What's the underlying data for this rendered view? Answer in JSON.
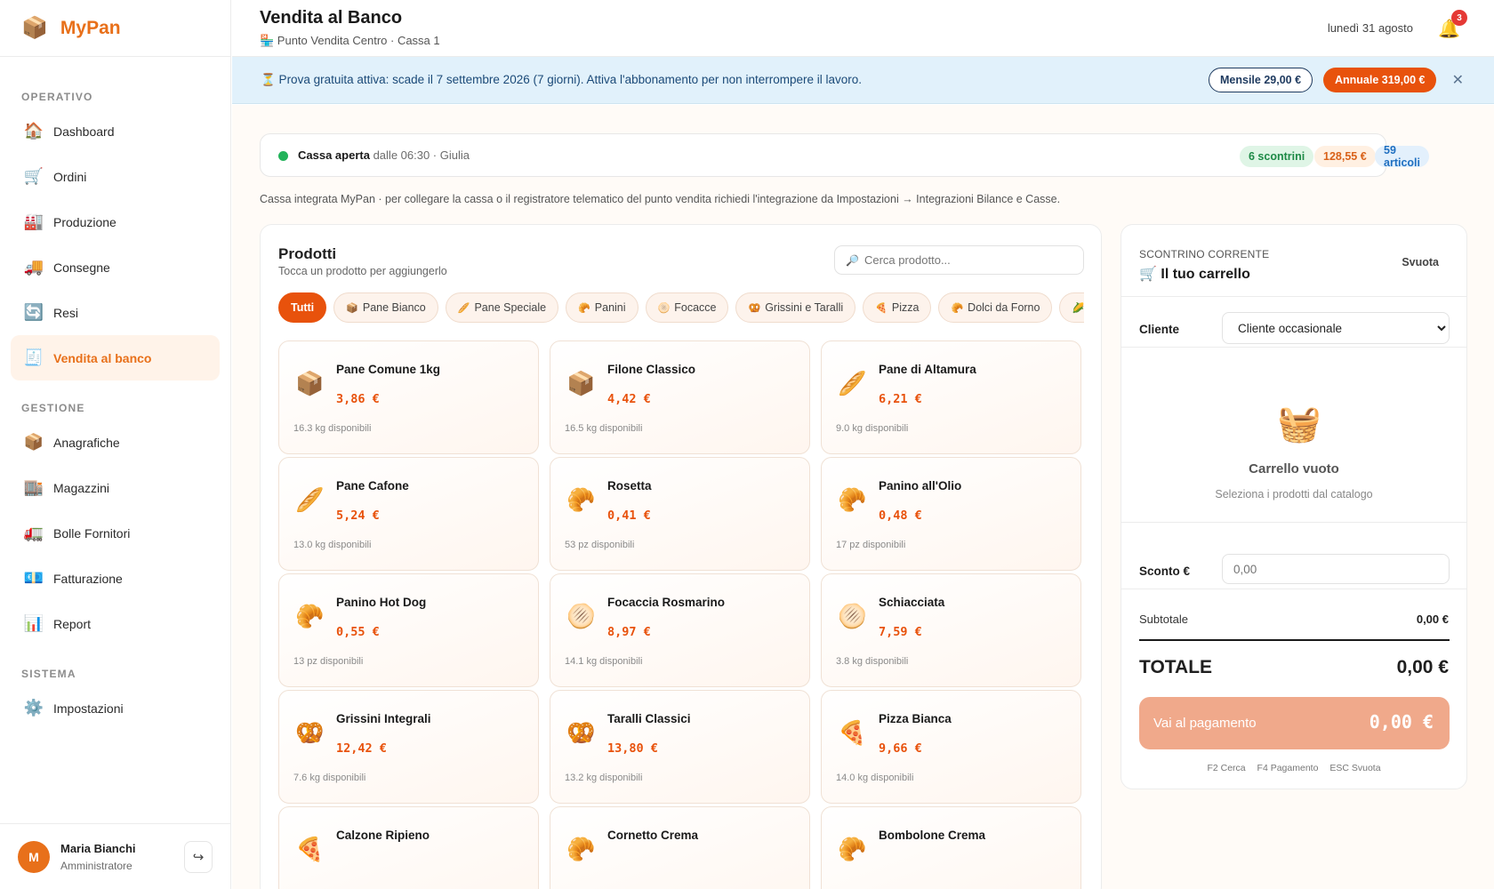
{
  "brand": {
    "logo": "📦",
    "name": "MyPan"
  },
  "sidebar": {
    "sections": [
      "OPERATIVO",
      "GESTIONE",
      "SISTEMA"
    ],
    "items": [
      {
        "icon": "🏠",
        "label": "Dashboard"
      },
      {
        "icon": "🛒",
        "label": "Ordini"
      },
      {
        "icon": "🏭",
        "label": "Produzione"
      },
      {
        "icon": "🚚",
        "label": "Consegne"
      },
      {
        "icon": "🔄",
        "label": "Resi"
      },
      {
        "icon": "🧾",
        "label": "Vendita al banco",
        "active": true
      },
      {
        "icon": "📦",
        "label": "Anagrafiche"
      },
      {
        "icon": "🏬",
        "label": "Magazzini"
      },
      {
        "icon": "🚛",
        "label": "Bolle Fornitori"
      },
      {
        "icon": "💶",
        "label": "Fatturazione"
      },
      {
        "icon": "📊",
        "label": "Report"
      },
      {
        "icon": "⚙️",
        "label": "Impostazioni"
      }
    ],
    "user": {
      "initial": "M",
      "name": "Maria Bianchi",
      "role": "Amministratore",
      "logout_icon": "↪"
    }
  },
  "header": {
    "title": "Vendita al Banco",
    "subtitle": "🏪 Punto Vendita Centro · Cassa 1",
    "date": "lunedì 31 agosto",
    "notifications_count": "3"
  },
  "banner": {
    "text": "⏳ Prova gratuita attiva: scade il 7 settembre 2026 (7 giorni). Attiva l'abbonamento per non interrompere il lavoro.",
    "monthly_label": "Mensile 29,00 €",
    "annual_label": "Annuale 319,00 €",
    "close_icon": "✕"
  },
  "cassa": {
    "status_label": "Cassa aperta",
    "status_detail": "dalle 06:30 · Giulia",
    "receipts": "6 scontrini",
    "total": "128,55 €",
    "articles": "59 articoli",
    "info": "Cassa integrata MyPan · per collegare la cassa o il registratore telematico del punto vendita richiedi l'integrazione da Impostazioni → Integrazioni Bilance e Casse."
  },
  "products": {
    "title": "Prodotti",
    "subtitle": "Tocca un prodotto per aggiungerlo",
    "search_placeholder": "Cerca prodotto...",
    "categories": [
      {
        "icon": "",
        "label": "Tutti",
        "active": true
      },
      {
        "icon": "📦",
        "label": "Pane Bianco"
      },
      {
        "icon": "🥖",
        "label": "Pane Speciale"
      },
      {
        "icon": "🥐",
        "label": "Panini"
      },
      {
        "icon": "🫓",
        "label": "Focacce"
      },
      {
        "icon": "🥨",
        "label": "Grissini e Taralli"
      },
      {
        "icon": "🍕",
        "label": "Pizza"
      },
      {
        "icon": "🥐",
        "label": "Dolci da Forno"
      },
      {
        "icon": "🌽",
        "label": ""
      }
    ],
    "items": [
      {
        "icon": "📦",
        "name": "Pane Comune 1kg",
        "price": "3,86 €",
        "stock": "16.3 kg disponibili"
      },
      {
        "icon": "📦",
        "name": "Filone Classico",
        "price": "4,42 €",
        "stock": "16.5 kg disponibili"
      },
      {
        "icon": "🥖",
        "name": "Pane di Altamura",
        "price": "6,21 €",
        "stock": "9.0 kg disponibili"
      },
      {
        "icon": "🥖",
        "name": "Pane Cafone",
        "price": "5,24 €",
        "stock": "13.0 kg disponibili"
      },
      {
        "icon": "🥐",
        "name": "Rosetta",
        "price": "0,41 €",
        "stock": "53 pz disponibili"
      },
      {
        "icon": "🥐",
        "name": "Panino all'Olio",
        "price": "0,48 €",
        "stock": "17 pz disponibili"
      },
      {
        "icon": "🥐",
        "name": "Panino Hot Dog",
        "price": "0,55 €",
        "stock": "13 pz disponibili"
      },
      {
        "icon": "🫓",
        "name": "Focaccia Rosmarino",
        "price": "8,97 €",
        "stock": "14.1 kg disponibili"
      },
      {
        "icon": "🫓",
        "name": "Schiacciata",
        "price": "7,59 €",
        "stock": "3.8 kg disponibili"
      },
      {
        "icon": "🥨",
        "name": "Grissini Integrali",
        "price": "12,42 €",
        "stock": "7.6 kg disponibili"
      },
      {
        "icon": "🥨",
        "name": "Taralli Classici",
        "price": "13,80 €",
        "stock": "13.2 kg disponibili"
      },
      {
        "icon": "🍕",
        "name": "Pizza Bianca",
        "price": "9,66 €",
        "stock": "14.0 kg disponibili"
      },
      {
        "icon": "🍕",
        "name": "Calzone Ripieno",
        "price": "",
        "stock": ""
      },
      {
        "icon": "🥐",
        "name": "Cornetto Crema",
        "price": "",
        "stock": ""
      },
      {
        "icon": "🥐",
        "name": "Bombolone Crema",
        "price": "",
        "stock": ""
      }
    ]
  },
  "cart": {
    "kicker": "SCONTRINO CORRENTE",
    "title": "🛒 Il tuo carrello",
    "clear_label": "Svuota",
    "cliente_label": "Cliente",
    "cliente_value": "Cliente occasionale",
    "empty_icon": "🧺",
    "empty_title": "Carrello vuoto",
    "empty_subtitle": "Seleziona i prodotti dal catalogo",
    "sconto_label": "Sconto €",
    "sconto_placeholder": "0,00",
    "subtotal_label": "Subtotale",
    "subtotal_value": "0,00 €",
    "total_label": "TOTALE",
    "total_value": "0,00 €",
    "pay_label": "Vai al pagamento",
    "pay_value": "0,00 €",
    "shortcuts": [
      "F2 Cerca",
      "F4 Pagamento",
      "ESC Svuota"
    ]
  },
  "colors": {
    "accent": "#e8520c",
    "brand": "#e8701a",
    "banner_bg": "#e1f1fb",
    "success": "#22b35a"
  }
}
